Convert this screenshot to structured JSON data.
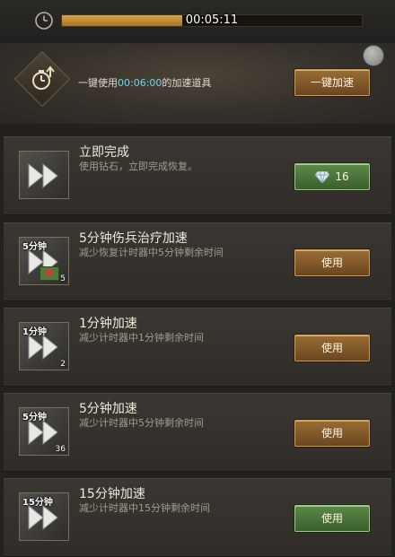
{
  "timer": {
    "remaining": "00:05:11",
    "progress_fraction": 0.4
  },
  "quick_use": {
    "prefix": "一键使用",
    "duration": "00:06:00",
    "suffix": "的加速道具",
    "button_label": "一键加速"
  },
  "items": [
    {
      "title": "立即完成",
      "desc": "使用钻石，立即完成恢复。",
      "thumb_label": "",
      "count": "",
      "button_label": "16",
      "button_icon": "diamond-icon"
    },
    {
      "title": "5分钟伤兵治疗加速",
      "desc": "减少恢复计时器中5分钟剩余时间",
      "thumb_label": "5分钟",
      "count": "5",
      "button_label": "使用"
    },
    {
      "title": "1分钟加速",
      "desc": "减少计时器中1分钟剩余时间",
      "thumb_label": "1分钟",
      "count": "2",
      "button_label": "使用"
    },
    {
      "title": "5分钟加速",
      "desc": "减少计时器中5分钟剩余时间",
      "thumb_label": "5分钟",
      "count": "36",
      "button_label": "使用"
    },
    {
      "title": "15分钟加速",
      "desc": "减少计时器中15分钟剩余时间",
      "thumb_label": "15分钟",
      "count": "",
      "button_label": "使用"
    }
  ]
}
